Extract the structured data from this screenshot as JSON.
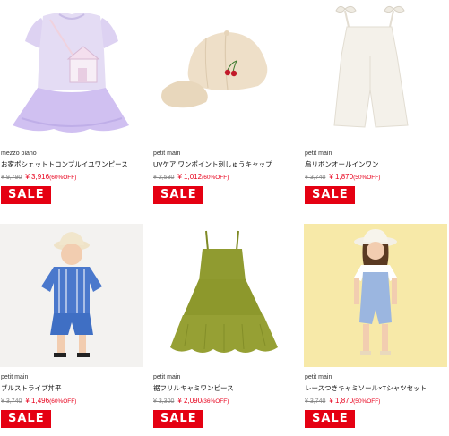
{
  "currency": "¥",
  "badge_label": "SALE",
  "products": [
    {
      "brand": "mezzo piano",
      "title": "お家ポシェットトロンプルイユワンピース",
      "original_price": "¥ 9,790",
      "sale_price": "¥ 3,916",
      "discount": "(60%OFF)",
      "image_icon": "lavender-dress-image"
    },
    {
      "brand": "petit main",
      "title": "UVケア ワンポイント刺しゅうキャップ",
      "original_price": "¥ 2,530",
      "sale_price": "¥ 1,012",
      "discount": "(60%OFF)",
      "image_icon": "beige-cap-image"
    },
    {
      "brand": "petit main",
      "title": "肩リボンオールインワン",
      "original_price": "¥ 3,740",
      "sale_price": "¥ 1,870",
      "discount": "(50%OFF)",
      "image_icon": "white-jumpsuit-image"
    },
    {
      "brand": "petit main",
      "title": "ブルストライプ丼平",
      "original_price": "¥ 3,740",
      "sale_price": "¥ 1,496",
      "discount": "(60%OFF)",
      "image_icon": "boy-blue-stripe-set-image"
    },
    {
      "brand": "petit main",
      "title": "裾フリルキャミワンピース",
      "original_price": "¥ 3,300",
      "sale_price": "¥ 2,090",
      "discount": "(36%OFF)",
      "image_icon": "green-camisole-dress-image"
    },
    {
      "brand": "petit main",
      "title": "レースつきキャミソール×Tシャツセット",
      "original_price": "¥ 3,740",
      "sale_price": "¥ 1,870",
      "discount": "(50%OFF)",
      "image_icon": "girl-blue-romper-image"
    }
  ],
  "colors": {
    "sale_red": "#e50012",
    "price_red": "#e8001c",
    "dress_lavender": "#d9cdf0",
    "cap_beige": "#eddcc4",
    "jumpsuit_white": "#f4f1ea",
    "stripe_blue": "#3f6fc4",
    "dress_green": "#8f9a2e",
    "romper_blue": "#9bb6e0"
  }
}
